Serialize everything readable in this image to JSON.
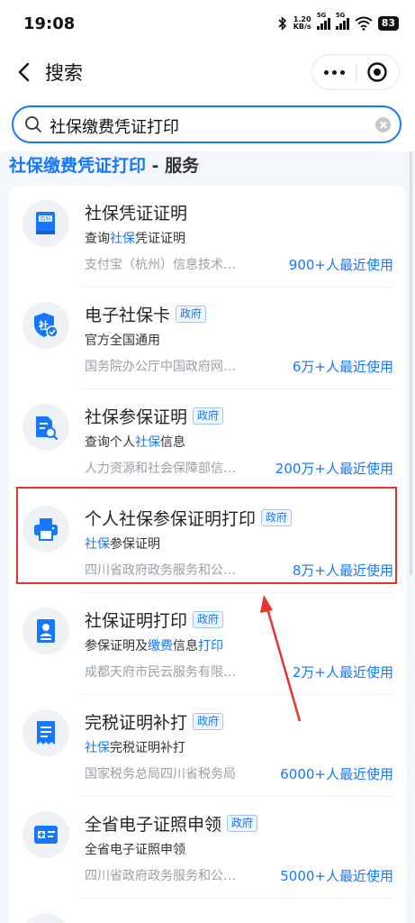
{
  "status": {
    "time": "19:08",
    "net_speed_value": "1.20",
    "net_speed_unit": "KB/s",
    "signal_1": "5G",
    "signal_2": "5G",
    "battery": "83"
  },
  "nav": {
    "title": "搜索"
  },
  "search": {
    "query": "社保缴费凭证打印"
  },
  "section": {
    "query": "社保缴费凭证打印",
    "suffix": " - 服务"
  },
  "results": [
    {
      "title": "社保凭证证明",
      "gov": "",
      "desc": [
        {
          "t": "查询",
          "h": false
        },
        {
          "t": "社保",
          "h": true
        },
        {
          "t": "凭证证明",
          "h": false
        }
      ],
      "org": "支付宝（杭州）信息技术…",
      "users": "900+人最近使用",
      "icon": "encyclopedia-book-icon"
    },
    {
      "title": "电子社保卡",
      "gov": "政府",
      "desc": [
        {
          "t": "官方全国通用",
          "h": false
        }
      ],
      "org": "国务院办公厅中国政府网…",
      "users": "6万+人最近使用",
      "icon": "social-security-shield-icon"
    },
    {
      "title": "社保参保证明",
      "gov": "政府",
      "desc": [
        {
          "t": "查询个人",
          "h": false
        },
        {
          "t": "社保",
          "h": true
        },
        {
          "t": "信息",
          "h": false
        }
      ],
      "org": "人力资源和社会保障部信…",
      "users": "200万+人最近使用",
      "icon": "document-search-icon"
    },
    {
      "title": "个人社保参保证明打印",
      "gov": "政府",
      "desc": [
        {
          "t": "社保",
          "h": true
        },
        {
          "t": "参保证明",
          "h": false
        }
      ],
      "org": "四川省政府政务服务和公…",
      "users": "8万+人最近使用",
      "icon": "printer-icon"
    },
    {
      "title": "社保证明打印",
      "gov": "政府",
      "desc": [
        {
          "t": "参保证明及",
          "h": false
        },
        {
          "t": "缴费",
          "h": true
        },
        {
          "t": "信息",
          "h": false
        },
        {
          "t": "打印",
          "h": true
        }
      ],
      "org": "成都天府市民云服务有限…",
      "users": "2万+人最近使用",
      "icon": "id-document-icon"
    },
    {
      "title": "完税证明补打",
      "gov": "政府",
      "desc": [
        {
          "t": "社保",
          "h": true
        },
        {
          "t": "完税证明补打",
          "h": false
        }
      ],
      "org": "国家税务总局四川省税务局",
      "users": "6000+人最近使用",
      "icon": "tax-receipt-icon"
    },
    {
      "title": "全省电子证照申领",
      "gov": "政府",
      "desc": [
        {
          "t": "全省电子证照申领",
          "h": false
        }
      ],
      "org": "四川省政府政务服务和公…",
      "users": "5000+人最近使用",
      "icon": "id-card-icon"
    }
  ],
  "colors": {
    "accent": "#1677ff",
    "annotation": "#e8322e"
  }
}
